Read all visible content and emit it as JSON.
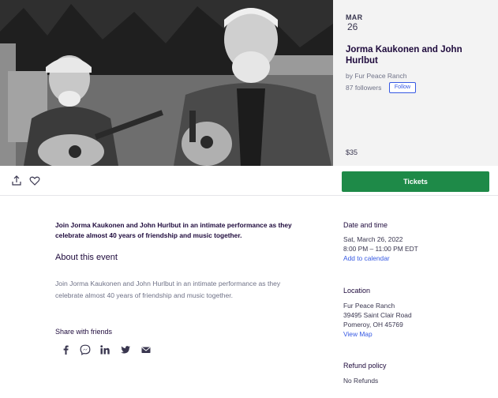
{
  "hero": {
    "date_month": "MAR",
    "date_day": "26",
    "title": "Jorma Kaukonen and John Hurlbut",
    "organizer": "by Fur Peace Ranch",
    "followers": "87 followers",
    "follow_label": "Follow",
    "price": "$35"
  },
  "actions": {
    "share_icon": "share-icon",
    "like_icon": "heart-icon",
    "tickets_label": "Tickets"
  },
  "main": {
    "summary": "Join Jorma Kaukonen and John Hurlbut in an intimate performance as they celebrate almost 40 years of friendship and music together.",
    "about_heading": "About this event",
    "about_body": "Join Jorma Kaukonen and John Hurlbut in an intimate performance as they celebrate almost 40 years of friendship and music together.",
    "share_heading": "Share with friends",
    "social_icons": [
      "facebook-icon",
      "messenger-icon",
      "linkedin-icon",
      "twitter-icon",
      "email-icon"
    ]
  },
  "sidebar": {
    "date_heading": "Date and time",
    "date_line": "Sat, March 26, 2022",
    "time_line": "8:00 PM – 11:00 PM EDT",
    "add_calendar": "Add to calendar",
    "location_heading": "Location",
    "venue": "Fur Peace Ranch",
    "address_line1": "39495 Saint Clair Road",
    "address_line2": "Pomeroy, OH 45769",
    "view_map": "View Map",
    "refund_heading": "Refund policy",
    "refund_text": "No Refunds"
  },
  "colors": {
    "tickets_bg": "#1e8a48",
    "link": "#3659e3",
    "text": "#1e0a3c",
    "muted": "#6f7287"
  }
}
